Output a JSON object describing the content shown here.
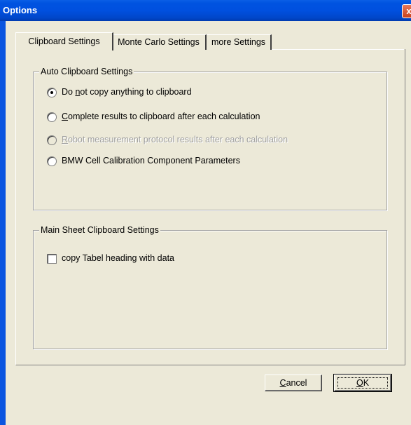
{
  "window": {
    "title": "Options",
    "close_glyph": "x"
  },
  "tabs": [
    {
      "label": "Clipboard Settings",
      "active": true
    },
    {
      "label": "Monte Carlo Settings",
      "active": false
    },
    {
      "label": "more Settings",
      "active": false
    }
  ],
  "auto_group": {
    "legend": "Auto Clipboard Settings",
    "options": [
      {
        "pre": "Do ",
        "ul": "n",
        "post": "ot copy anything to clipboard",
        "selected": true,
        "enabled": true
      },
      {
        "pre": "",
        "ul": "C",
        "post": "omplete results to clipboard after each calculation",
        "selected": false,
        "enabled": true
      },
      {
        "pre": "",
        "ul": "R",
        "post": "obot measurement protocol results after each calculation",
        "selected": false,
        "enabled": false
      },
      {
        "pre": "",
        "ul": "",
        "post": "BMW Cell Calibration Component Parameters",
        "selected": false,
        "enabled": true
      }
    ]
  },
  "main_group": {
    "legend": "Main Sheet Clipboard Settings",
    "checkbox_label": "copy Tabel heading with data",
    "checked": false
  },
  "buttons": {
    "cancel_ul": "C",
    "cancel_rest": "ancel",
    "ok_ul": "O",
    "ok_rest": "K"
  }
}
